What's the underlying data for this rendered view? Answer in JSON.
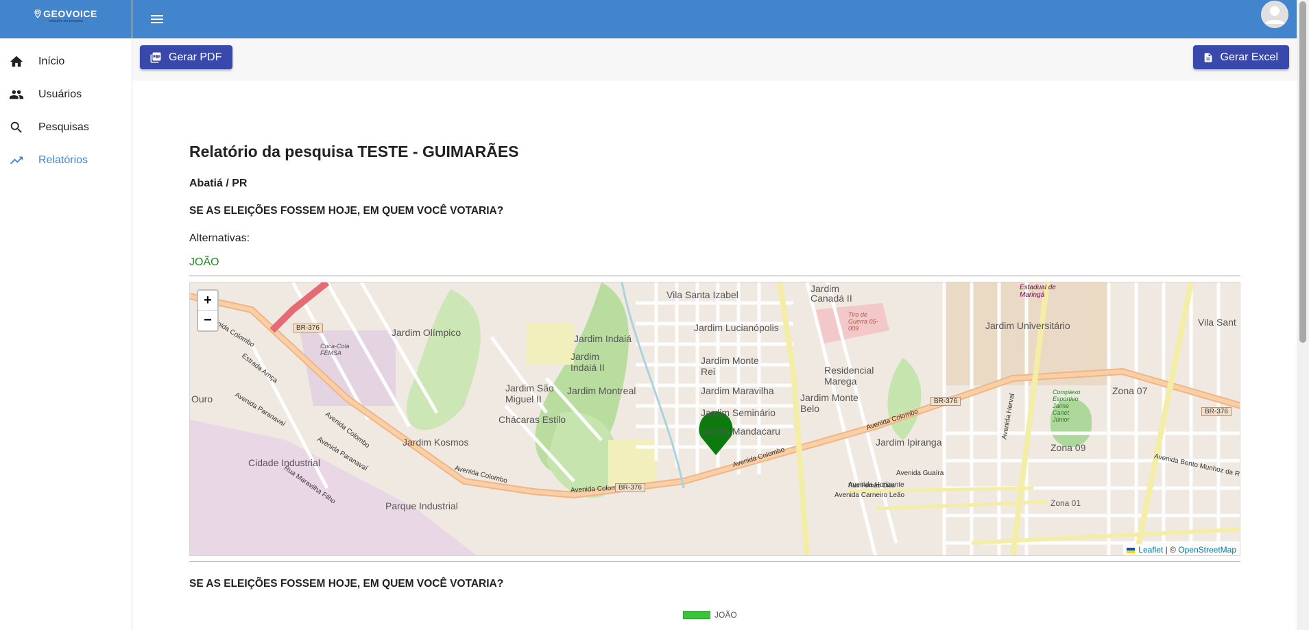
{
  "app": {
    "name": "GEOVOICE",
    "tagline": "soluções em pesquisa"
  },
  "sidebar": {
    "items": [
      {
        "label": "Início",
        "icon": "home-icon"
      },
      {
        "label": "Usuários",
        "icon": "people-icon"
      },
      {
        "label": "Pesquisas",
        "icon": "search-icon"
      },
      {
        "label": "Relatórios",
        "icon": "trending-up-icon",
        "active": true
      }
    ]
  },
  "toolbar": {
    "pdf_label": "Gerar PDF",
    "excel_label": "Gerar Excel"
  },
  "report": {
    "title": "Relatório da pesquisa TESTE - GUIMARÃES",
    "city": "Abatiá / PR",
    "question": "SE AS ELEIÇÕES FOSSEM HOJE, EM QUEM VOCÊ VOTARIA?",
    "alternatives_label": "Alternativas:",
    "alternatives": [
      "JOÃO"
    ],
    "question2": "SE AS ELEIÇÕES FOSSEM HOJE, EM QUEM VOCÊ VOTARIA?",
    "legend": "JOÃO"
  },
  "map": {
    "zoom_in": "+",
    "zoom_out": "−",
    "attribution_leaflet": "Leaflet",
    "attribution_sep": " | © ",
    "attribution_osm": "OpenStreetMap",
    "labels": [
      "Vila Santa Izabel",
      "Jardim Canadá II",
      "Jardim Lucianópolis",
      "Jardim Olímpico",
      "Coca-Cola FEMSA",
      "Jardim Indaiá",
      "Jardim Indaiá II",
      "Jardim Monte Rei",
      "Jardim Maravilha",
      "Jardim Montreal",
      "Jardim São Miguel II",
      "Chácaras Estilo",
      "Jardim Kosmos",
      "Cidade Industrial",
      "Jardim Seminário",
      "Jardim Mandacaru",
      "Residencial Marega",
      "Jardim Monte Belo",
      "Jardim Ipiranga",
      "Jardim Universitário",
      "Zona 07",
      "Zona 09",
      "Zona 01",
      "Vila Sant",
      "Ouro",
      "Parque Industrial",
      "Tiro de Guerra 05-009",
      "Complexo Esportivo Jaime Canet Júnior",
      "Estadual de Maringá"
    ],
    "streets": [
      "Avenida Colombo",
      "Estrada Arnça",
      "Avenida Paranavaí",
      "Rua Maravilha Filho",
      "Avenida Horizonte",
      "Rua Fernão Dias",
      "Avenida Carneiro Leão",
      "Avenida Guaíra",
      "Avenida Herval",
      "Avenida Bento Munhoz da Ro"
    ],
    "shields": [
      "BR-376",
      "BR-376",
      "BR-376",
      "BR-376"
    ]
  }
}
